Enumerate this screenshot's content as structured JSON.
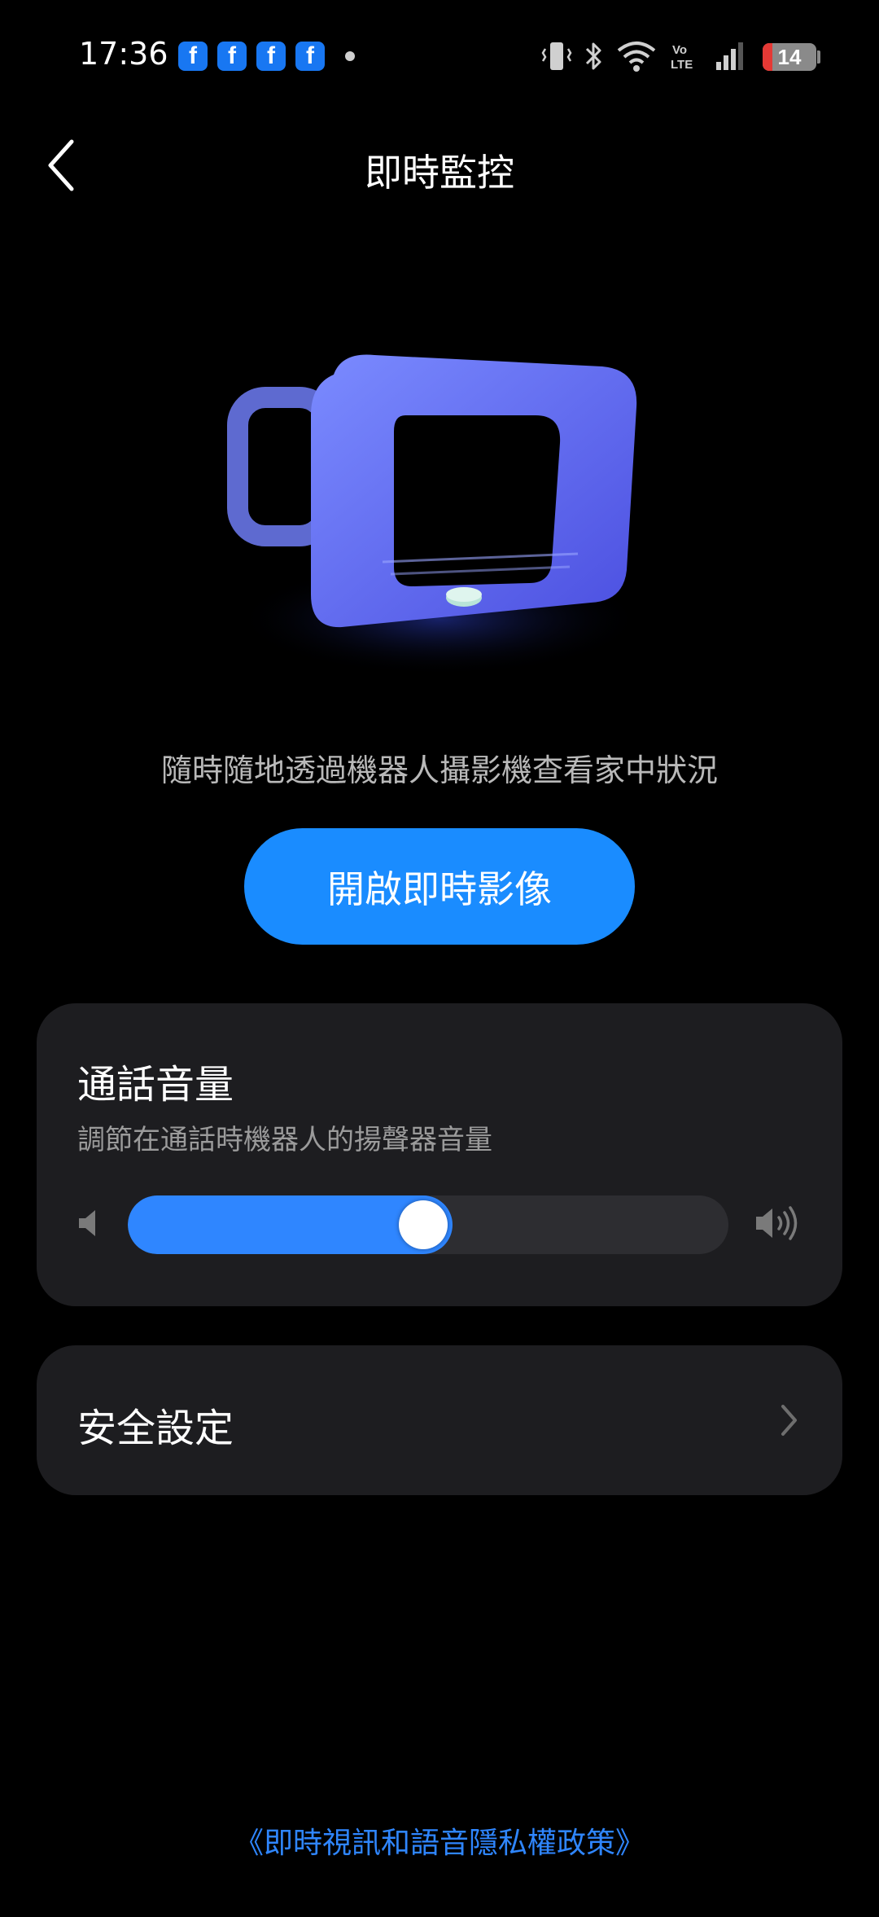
{
  "status_bar": {
    "time": "17:36",
    "notification_icons": [
      "facebook-icon",
      "facebook-icon",
      "facebook-icon",
      "facebook-icon"
    ],
    "fb_glyph": "f",
    "battery_level": "14",
    "battery_color": "#e53935"
  },
  "header": {
    "title": "即時監控"
  },
  "hero": {
    "tagline": "隨時隨地透過機器人攝影機查看家中狀況",
    "cta_label": "開啟即時影像"
  },
  "volume": {
    "title": "通話音量",
    "subtitle": "調節在通話時機器人的揚聲器音量",
    "level_fraction": 0.54
  },
  "security": {
    "label": "安全設定"
  },
  "footer": {
    "privacy_link": "《即時視訊和語音隱私權政策》"
  },
  "colors": {
    "accent": "#1a8cff",
    "slider_fill": "#2f86ff",
    "card_bg": "#1d1d20",
    "background": "#000000"
  }
}
